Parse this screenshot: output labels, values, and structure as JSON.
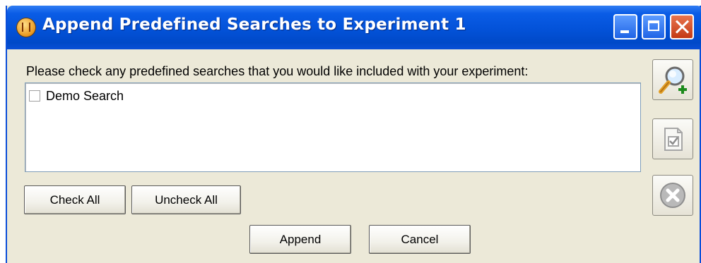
{
  "window": {
    "title": "Append Predefined Searches to Experiment 1",
    "app_icon": "orbitrap-app-icon",
    "controls": [
      "minimize",
      "maximize",
      "close"
    ]
  },
  "prompt": "Please check  any predefined searches that you would like included with your experiment:",
  "searches": [
    {
      "label": "Demo Search",
      "checked": false
    }
  ],
  "buttons": {
    "check_all": "Check All",
    "uncheck_all": "Uncheck All",
    "append": "Append",
    "cancel": "Cancel"
  },
  "side_buttons": [
    {
      "icon": "magnifier-add-icon",
      "enabled": true
    },
    {
      "icon": "document-check-icon",
      "enabled": false
    },
    {
      "icon": "remove-circle-icon",
      "enabled": false
    }
  ],
  "colors": {
    "titlebar": "#0352d8",
    "dialog_bg": "#ece9d8",
    "close_button": "#c43a14"
  }
}
